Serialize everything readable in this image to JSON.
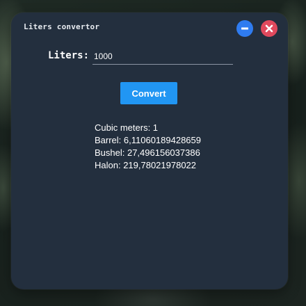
{
  "window": {
    "title": "Liters convertor",
    "colors": {
      "panel": "#232f3e",
      "minimize": "#2f7cf0",
      "close": "#e0495d",
      "accent": "#2196f3"
    }
  },
  "controls": {
    "minimize_icon": "minus-icon",
    "close_icon": "x-icon"
  },
  "form": {
    "label": "Liters:",
    "value": "1000",
    "button_label": "Convert"
  },
  "results": [
    "Cubic meters: 1",
    "Barrel: 6,11060189428659",
    "Bushel: 27,496156037386",
    "Halon: 219,78021978022"
  ]
}
